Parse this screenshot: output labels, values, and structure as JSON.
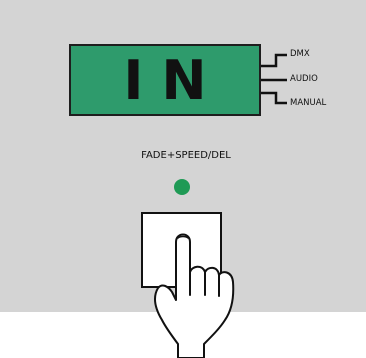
{
  "display": {
    "text": "IN",
    "color": "#2e9b6c"
  },
  "modes": [
    "DMX",
    "AUDIO",
    "MANUAL"
  ],
  "button": {
    "label": "FADE+SPEED/DEL",
    "led_color": "#1f9a55"
  },
  "icons": {
    "hand": "pointing-hand-icon"
  }
}
